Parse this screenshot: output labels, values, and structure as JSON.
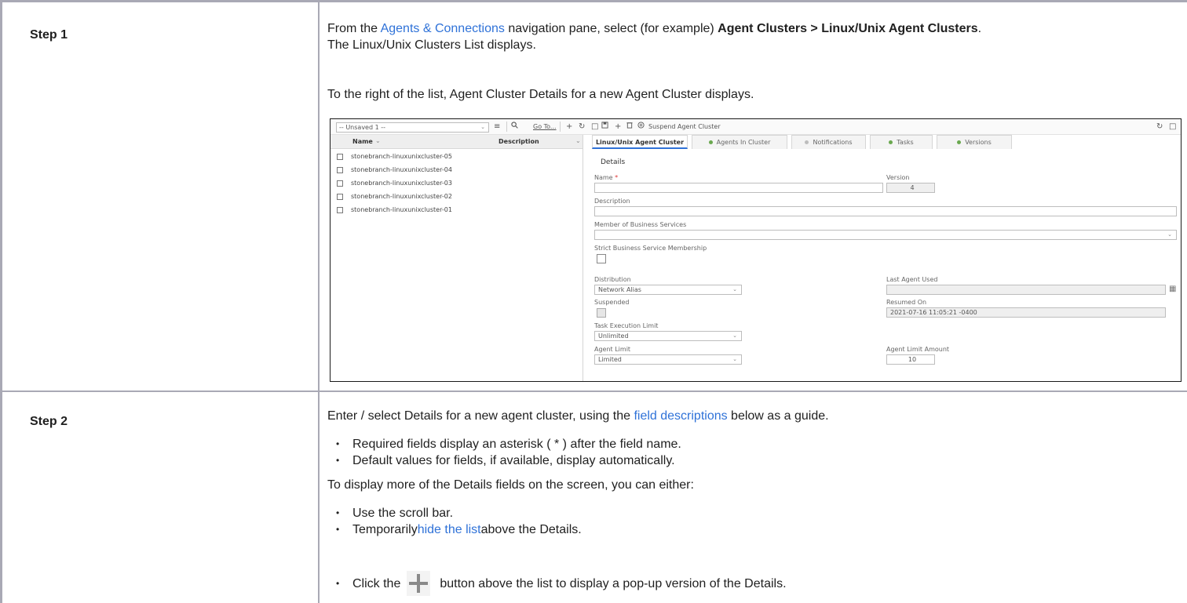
{
  "step1": {
    "label": "Step 1",
    "line1_pre": "From the ",
    "line1_link": "Agents & Connections",
    "line1_mid": " navigation pane, select (for example) ",
    "line1_bold": "Agent Clusters > Linux/Unix Agent Clusters",
    "line1_end": ".",
    "line2": "The Linux/Unix Clusters List displays.",
    "line3": "To the right of the list, Agent Cluster Details for a new Agent Cluster displays."
  },
  "screenshot": {
    "filter_value": "-- Unsaved 1 --",
    "goto_label": "Go To...",
    "suspend_label": "Suspend Agent Cluster",
    "list": {
      "col_name": "Name",
      "col_description": "Description",
      "rows": [
        "stonebranch-linuxunixcluster-05",
        "stonebranch-linuxunixcluster-04",
        "stonebranch-linuxunixcluster-03",
        "stonebranch-linuxunixcluster-02",
        "stonebranch-linuxunixcluster-01"
      ]
    },
    "tabs": [
      {
        "label": "Linux/Unix Agent Cluster"
      },
      {
        "label": "Agents In Cluster"
      },
      {
        "label": "Notifications"
      },
      {
        "label": "Tasks"
      },
      {
        "label": "Versions"
      }
    ],
    "details": {
      "section_title": "Details",
      "name_label": "Name",
      "name_required": "*",
      "name_value": "",
      "version_label": "Version",
      "version_value": "4",
      "description_label": "Description",
      "description_value": "",
      "member_label": "Member of Business Services",
      "member_value": "",
      "strict_label": "Strict Business Service Membership",
      "distribution_label": "Distribution",
      "distribution_value": "Network Alias",
      "last_agent_label": "Last Agent Used",
      "last_agent_value": "",
      "suspended_label": "Suspended",
      "resumed_label": "Resumed On",
      "resumed_value": "2021-07-16 11:05:21 -0400",
      "task_limit_label": "Task Execution Limit",
      "task_limit_value": "Unlimited",
      "agent_limit_label": "Agent Limit",
      "agent_limit_value": "Limited",
      "agent_limit_amount_label": "Agent Limit Amount",
      "agent_limit_amount_value": "10"
    }
  },
  "step2": {
    "label": "Step 2",
    "line1_pre": "Enter / select Details for a new agent cluster, using the ",
    "line1_link": "field descriptions",
    "line1_end": " below as a guide.",
    "bullets_a": [
      "Required fields display an asterisk ( * ) after the field name.",
      "Default values for fields, if available, display automatically."
    ],
    "line2": "To display more of the Details fields on the screen, you can either:",
    "bullet_scroll": "Use the scroll bar.",
    "bullet_hide_pre": "Temporarily ",
    "bullet_hide_link": "hide the list",
    "bullet_hide_end": " above the Details.",
    "bullet_click_pre": "Click the ",
    "bullet_click_end": " button above the list to display a pop-up version of the Details."
  }
}
